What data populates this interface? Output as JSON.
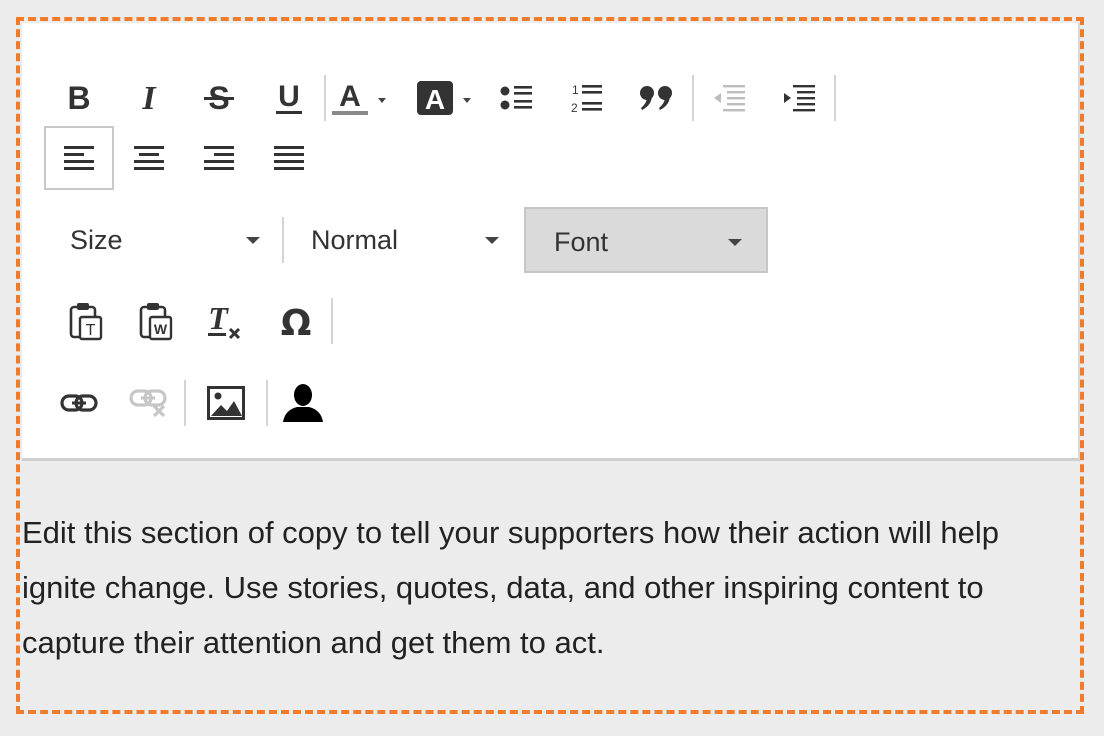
{
  "editor": {
    "accent_color": "#f07c2b",
    "toolbar_rows": {
      "row1": [
        "bold",
        "italic",
        "strikethrough",
        "underline",
        "text-color",
        "background-color",
        "bulleted-list",
        "numbered-list",
        "blockquote",
        "decrease-indent",
        "increase-indent"
      ],
      "row2": [
        "align-left",
        "align-center",
        "align-right",
        "justify"
      ],
      "row4": [
        "paste-as-text",
        "paste-from-word",
        "remove-format",
        "special-character"
      ],
      "row5": [
        "link",
        "unlink",
        "image",
        "person"
      ]
    },
    "dropdowns": {
      "size_label": "Size",
      "format_label": "Normal",
      "font_label": "Font"
    },
    "content_text": "Edit this section of copy to tell your supporters how their action will help ignite change. Use stories, quotes, data, and other inspiring content to capture their attention and get them to act."
  }
}
